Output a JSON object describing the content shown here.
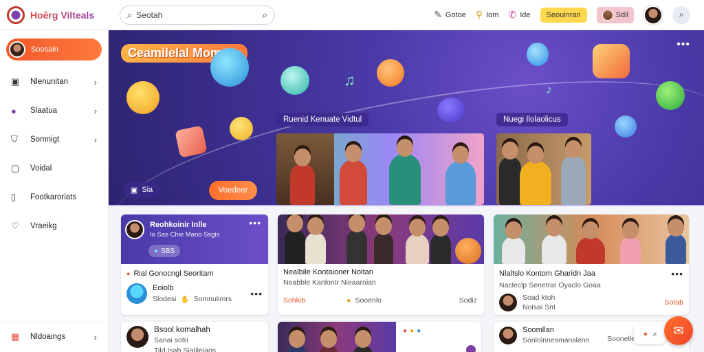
{
  "app": {
    "name": "Hoêrg Vilteals"
  },
  "search": {
    "placeholder": "Seotah"
  },
  "top_actions": [
    {
      "icon": "edit-icon",
      "label": "Gotoe"
    },
    {
      "icon": "search-icon",
      "label": "Iom"
    },
    {
      "icon": "notification-icon",
      "label": "Ide"
    }
  ],
  "top_yellow_button": "Seouinran",
  "top_pink_button": "Sdil",
  "sidebar": {
    "active_label": "Soosain",
    "items": [
      {
        "icon": "image-icon",
        "label": "Nlenunitan",
        "chevron": true
      },
      {
        "icon": "chat-icon",
        "label": "Slaatua",
        "chevron": true
      },
      {
        "icon": "shield-icon",
        "label": "Somnigt",
        "chevron": true
      },
      {
        "icon": "video-icon",
        "label": "Voidal",
        "chevron": false
      },
      {
        "icon": "document-icon",
        "label": "Footkaroriats",
        "chevron": false
      },
      {
        "icon": "heart-icon",
        "label": "Vraeikg",
        "chevron": false
      }
    ],
    "bottom": {
      "icon": "gift-icon",
      "label": "Nldoaings"
    }
  },
  "hero": {
    "title": "Ceamilelal Momnrs",
    "video1_label": "Ruenid Kenuate Vidtul",
    "video2_label": "Nuegi Ilolaolicus",
    "chip_label": "Sia",
    "button_label": "Voedeer"
  },
  "cards": {
    "c1": {
      "head_title": "Reohkoinir Inlle",
      "head_sub": "Io Sas Chie Mano Ssgis",
      "head_chip": "SBS",
      "title": "Rial Gonocngl Seoritam",
      "user_name": "Eoiolb",
      "user_meta": "Slodesi",
      "user_extra": "Somnulimrs"
    },
    "c2": {
      "title": "Nealbile Kontaioner Noitan",
      "subtitle": "Neabble Kanlontr Nieaaroian",
      "left": "Sohkib",
      "middle": "Sooenlo",
      "right": "Sodiz"
    },
    "c3": {
      "title": "Nlaltslo Kontom Gharidn Jaa",
      "subtitle": "Nacleclp Senetrar Oyaclo Goaa",
      "user_name": "Soad ktoh",
      "user_meta": "Noisai Snt",
      "right": "Sotab"
    },
    "c4": {
      "title": "Bsool komalhah",
      "sub1": "Sanai sotri",
      "sub2": "Tild Isab Siatileiaos"
    },
    "c6": {
      "title": "Soomllan",
      "subtitle": "Sonlolnnesmanslenn",
      "right": "Soonelle"
    }
  },
  "colors": {
    "accent": "#f0592a",
    "hero_bg": "#4a3aa8",
    "yellow": "#ffd84d"
  }
}
